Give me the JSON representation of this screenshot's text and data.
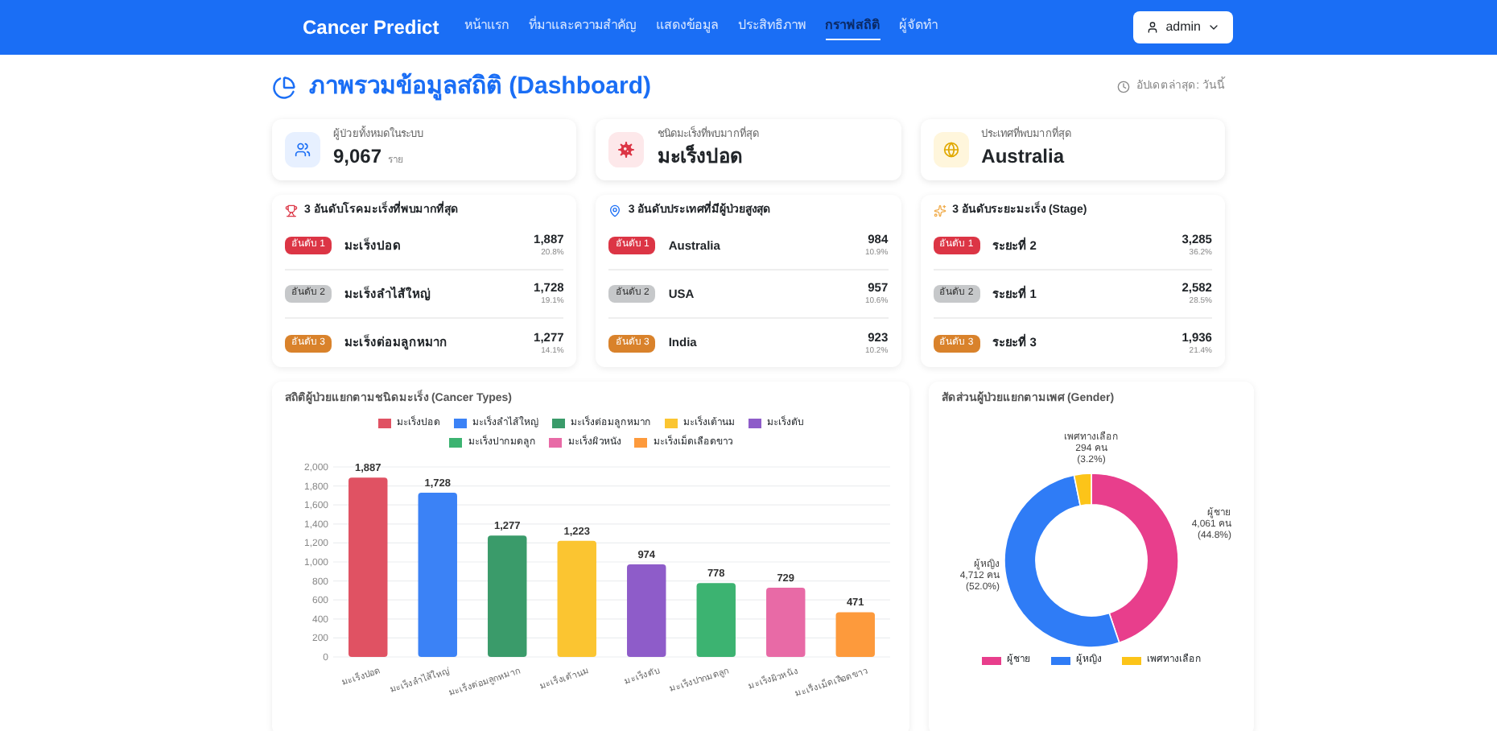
{
  "nav": {
    "brand": "Cancer Predict",
    "links": [
      {
        "label": "หน้าแรก",
        "selected": false
      },
      {
        "label": "ที่มาและความสำคัญ",
        "selected": false
      },
      {
        "label": "แสดงข้อมูล",
        "selected": false
      },
      {
        "label": "ประสิทธิภาพ",
        "selected": false
      },
      {
        "label": "กราฟสถิติ",
        "selected": true
      },
      {
        "label": "ผู้จัดทำ",
        "selected": false
      }
    ],
    "user": "admin"
  },
  "header": {
    "title": "ภาพรวมข้อมูลสถิติ (Dashboard)",
    "updated": "อัปเดตล่าสุด: วันนี้"
  },
  "stats": [
    {
      "kind": "people",
      "label": "ผู้ป่วยทั้งหมดในระบบ",
      "value": "9,067",
      "unit": "ราย"
    },
    {
      "kind": "virus",
      "label": "ชนิดมะเร็งที่พบมากที่สุด",
      "value": "มะเร็งปอด"
    },
    {
      "kind": "globe",
      "label": "ประเทศที่พบมากที่สุด",
      "value": "Australia"
    }
  ],
  "top_lists": [
    {
      "kind": "trophy",
      "title": "3 อันดับโรคมะเร็งที่พบมากที่สุด",
      "items": [
        {
          "rank": "อันดับ 1",
          "name": "มะเร็งปอด",
          "count": "1,887",
          "percent": "20.8%"
        },
        {
          "rank": "อันดับ 2",
          "name": "มะเร็งลำไส้ใหญ่",
          "count": "1,728",
          "percent": "19.1%"
        },
        {
          "rank": "อันดับ 3",
          "name": "มะเร็งต่อมลูกหมาก",
          "count": "1,277",
          "percent": "14.1%"
        }
      ]
    },
    {
      "kind": "pin",
      "title": "3 อันดับประเทศที่มีผู้ป่วยสูงสุด",
      "items": [
        {
          "rank": "อันดับ 1",
          "name": "Australia",
          "count": "984",
          "percent": "10.9%"
        },
        {
          "rank": "อันดับ 2",
          "name": "USA",
          "count": "957",
          "percent": "10.6%"
        },
        {
          "rank": "อันดับ 3",
          "name": "India",
          "count": "923",
          "percent": "10.2%"
        }
      ]
    },
    {
      "kind": "sparkle",
      "title": "3 อันดับระยะมะเร็ง (Stage)",
      "items": [
        {
          "rank": "อันดับ 1",
          "name": "ระยะที่ 2",
          "count": "3,285",
          "percent": "36.2%"
        },
        {
          "rank": "อันดับ 2",
          "name": "ระยะที่ 1",
          "count": "2,582",
          "percent": "28.5%"
        },
        {
          "rank": "อันดับ 3",
          "name": "ระยะที่ 3",
          "count": "1,936",
          "percent": "21.4%"
        }
      ]
    }
  ],
  "bar_card": {
    "title": "สถิติผู้ป่วยแยกตามชนิดมะเร็ง (Cancer Types)",
    "chart_data": {
      "type": "bar",
      "categories": [
        "มะเร็งปอด",
        "มะเร็งลำไส้ใหญ่",
        "มะเร็งต่อมลูกหมาก",
        "มะเร็งเต้านม",
        "มะเร็งตับ",
        "มะเร็งปากมดลูก",
        "มะเร็งผิวหนัง",
        "มะเร็งเม็ดเลือดขาว"
      ],
      "colors": [
        "#e05263",
        "#3b82f6",
        "#3a9b6a",
        "#fbc531",
        "#8e5cc9",
        "#3cb371",
        "#e86aa6",
        "#fd9a3c"
      ],
      "values": [
        1887,
        1728,
        1277,
        1223,
        974,
        778,
        729,
        471
      ],
      "value_labels": [
        "1,887",
        "1,728",
        "1,277",
        "1,223",
        "974",
        "778",
        "729",
        "471"
      ],
      "ylim": [
        0,
        2000
      ],
      "grid": true,
      "yticks": [
        {
          "value": 0,
          "label": "0"
        },
        {
          "value": 200,
          "label": "200"
        },
        {
          "value": 400,
          "label": "400"
        },
        {
          "value": 600,
          "label": "600"
        },
        {
          "value": 800,
          "label": "800"
        },
        {
          "value": 1000,
          "label": "1,000"
        },
        {
          "value": 1200,
          "label": "1,200"
        },
        {
          "value": 1400,
          "label": "1,400"
        },
        {
          "value": 1600,
          "label": "1,600"
        },
        {
          "value": 1800,
          "label": "1,800"
        },
        {
          "value": 2000,
          "label": "2,000"
        }
      ]
    }
  },
  "donut_card": {
    "title": "สัดส่วนผู้ป่วยแยกตามเพศ (Gender)",
    "chart_data": {
      "type": "donut",
      "categories": [
        "ผู้ชาย",
        "ผู้หญิง",
        "เพศทางเลือก"
      ],
      "colors": [
        "#e83e8c",
        "#2f7cf6",
        "#fcc419"
      ],
      "values": [
        44.8,
        52.0,
        3.2
      ],
      "value_labels": [
        {
          "name": "ผู้ชาย",
          "count": "4,061 คน",
          "percent": "(44.8%)"
        },
        {
          "name": "ผู้หญิง",
          "count": "4,712 คน",
          "percent": "(52.0%)"
        },
        {
          "name": "เพศทางเลือก",
          "count": "294 คน",
          "percent": "(3.2%)"
        }
      ]
    }
  }
}
